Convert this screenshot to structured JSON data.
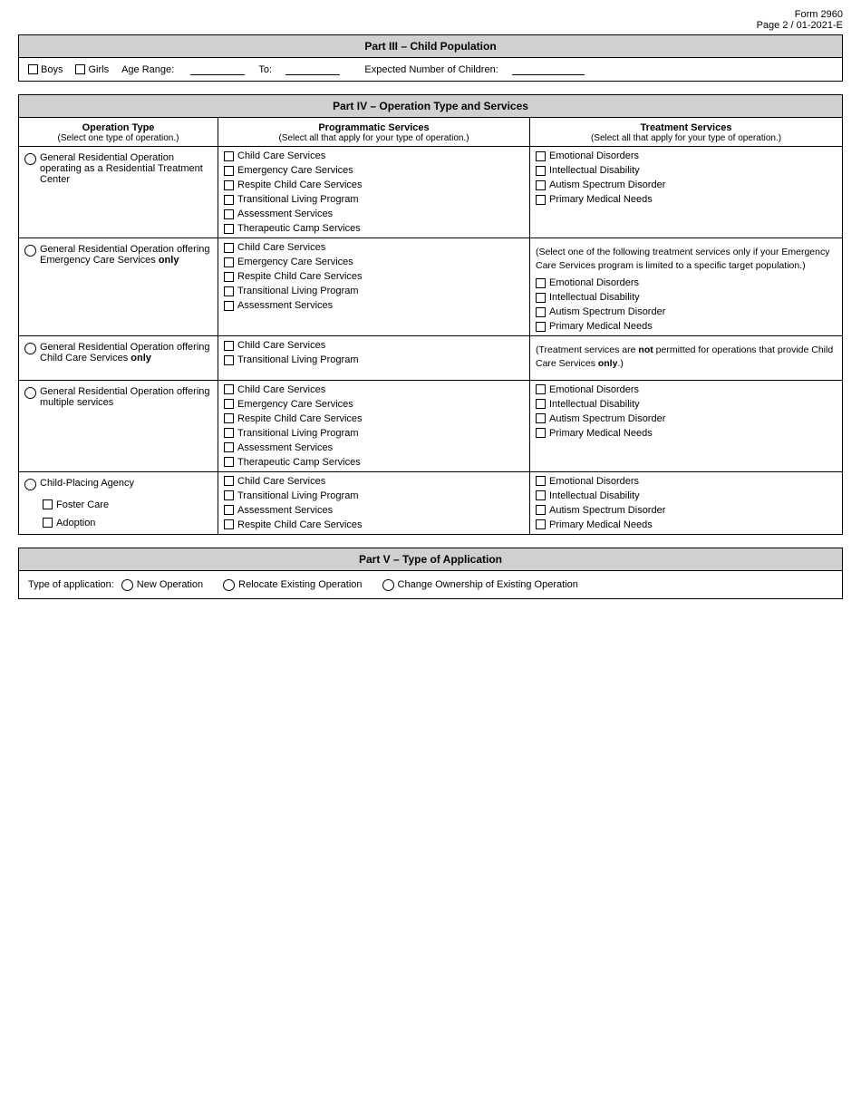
{
  "form": {
    "title": "Form 2960",
    "page": "Page 2 / 01-2021-E"
  },
  "part3": {
    "header": "Part III – Child Population",
    "boys_label": "Boys",
    "girls_label": "Girls",
    "age_range_label": "Age Range:",
    "to_label": "To:",
    "expected_label": "Expected Number of Children:"
  },
  "part4": {
    "header": "Part IV – Operation Type and Services",
    "col1_header": "Operation Type",
    "col1_sub": "(Select one type of operation.)",
    "col2_header": "Programmatic Services",
    "col2_sub": "(Select all that apply for your type of operation.)",
    "col3_header": "Treatment Services",
    "col3_sub": "(Select all that apply for your type of operation.)",
    "rows": [
      {
        "op_text": "General Residential Operation operating as a Residential Treatment Center",
        "prog_items": [
          "Child Care Services",
          "Emergency Care Services",
          "Respite Child Care Services",
          "Transitional Living Program",
          "Assessment Services",
          "Therapeutic Camp Services"
        ],
        "treat_items": [
          "Emotional Disorders",
          "Intellectual Disability",
          "Autism Spectrum Disorder",
          "Primary Medical Needs"
        ],
        "treat_note": ""
      },
      {
        "op_text": "General Residential Operation offering Emergency Care Services only",
        "prog_items": [
          "Child Care Services",
          "Emergency Care Services",
          "Respite Child Care Services",
          "Transitional Living Program",
          "Assessment Services"
        ],
        "treat_note": "(Select one of the following treatment services only if your Emergency Care Services program is limited to a specific target population.)",
        "treat_items": [
          "Emotional Disorders",
          "Intellectual Disability",
          "Autism Spectrum Disorder",
          "Primary Medical Needs"
        ]
      },
      {
        "op_text": "General Residential Operation offering Child Care Services only",
        "prog_items": [
          "Child Care Services",
          "Transitional Living Program"
        ],
        "treat_note": "(Treatment services are not permitted for operations that provide Child Care Services only.)",
        "treat_note_bold": "not",
        "treat_note_bold2": "only",
        "treat_items": []
      },
      {
        "op_text": "General Residential Operation offering multiple services",
        "prog_items": [
          "Child Care Services",
          "Emergency Care Services",
          "Respite Child Care Services",
          "Transitional Living Program",
          "Assessment Services",
          "Therapeutic Camp Services"
        ],
        "treat_items": [
          "Emotional Disorders",
          "Intellectual Disability",
          "Autism Spectrum Disorder",
          "Primary Medical Needs"
        ],
        "treat_note": ""
      },
      {
        "op_text": "Child-Placing Agency",
        "op_sub_items": [
          "Foster Care",
          "Adoption"
        ],
        "prog_items": [
          "Child Care Services",
          "Transitional Living Program",
          "Assessment Services",
          "Respite Child Care Services"
        ],
        "treat_items": [
          "Emotional Disorders",
          "Intellectual Disability",
          "Autism Spectrum Disorder",
          "Primary Medical Needs"
        ],
        "treat_note": ""
      }
    ]
  },
  "part5": {
    "header": "Part V – Type of Application",
    "label": "Type of application:",
    "options": [
      "New Operation",
      "Relocate Existing Operation",
      "Change Ownership of Existing Operation"
    ]
  }
}
